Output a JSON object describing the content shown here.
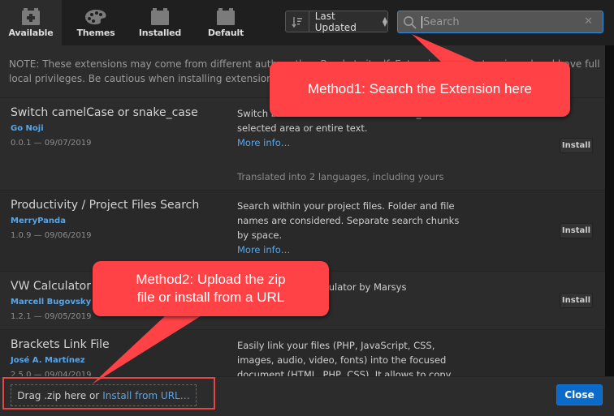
{
  "tabs": [
    {
      "label": "Available",
      "icon": "puzzle-plus-icon",
      "active": true
    },
    {
      "label": "Themes",
      "icon": "palette-icon",
      "active": false
    },
    {
      "label": "Installed",
      "icon": "puzzle-icon",
      "active": false
    },
    {
      "label": "Default",
      "icon": "puzzle-icon",
      "active": false
    }
  ],
  "sort": {
    "label": "Last Updated",
    "icon": "sort-icon"
  },
  "search": {
    "placeholder": "Search",
    "value": ""
  },
  "note": "NOTE: These extensions may come from different authors than Brackets itself. Extensions are not reviewed and have full local privileges. Be cautious when installing extensions from an unknown source.",
  "extensions": [
    {
      "title": "Switch camelCase or snake_case",
      "author": "Go Noji",
      "meta": "0.0.1 — 09/07/2019",
      "description": "Switch between camelCase and snake_case in selected area or entire text.",
      "more": "More info…",
      "translated": "Translated into 2 languages, including yours",
      "install": "Install"
    },
    {
      "title": "Productivity / Project Files Search",
      "author": "MerryPanda",
      "meta": "1.0.9 — 09/06/2019",
      "description": "Search within your project files. Folder and file names are considered. Separate search chunks by space.",
      "more": "More info…",
      "install": "Install"
    },
    {
      "title": "VW Calculator",
      "author": "Marcell Bugovsky",
      "meta": "1.2.1 — 09/05/2019",
      "description": "Viewport width calculator by Marsys Webproduction",
      "install": "Install"
    },
    {
      "title": "Brackets Link File",
      "author": "José A. Martínez",
      "meta": "2.5.0 — 09/04/2019",
      "description": "Easily link your files (PHP, JavaScript, CSS, images, audio, video, fonts) into the focused document (HTML, PHP, CSS). It allows to copy"
    }
  ],
  "footer": {
    "drag_text": "Drag .zip here or",
    "url_link": "Install from URL…",
    "close": "Close"
  },
  "annotations": {
    "method1": "Method1: Search the Extension here",
    "method2_line1": "Method2: Upload the zip",
    "method2_line2": "file or install from a URL",
    "color": "#ff4246"
  }
}
